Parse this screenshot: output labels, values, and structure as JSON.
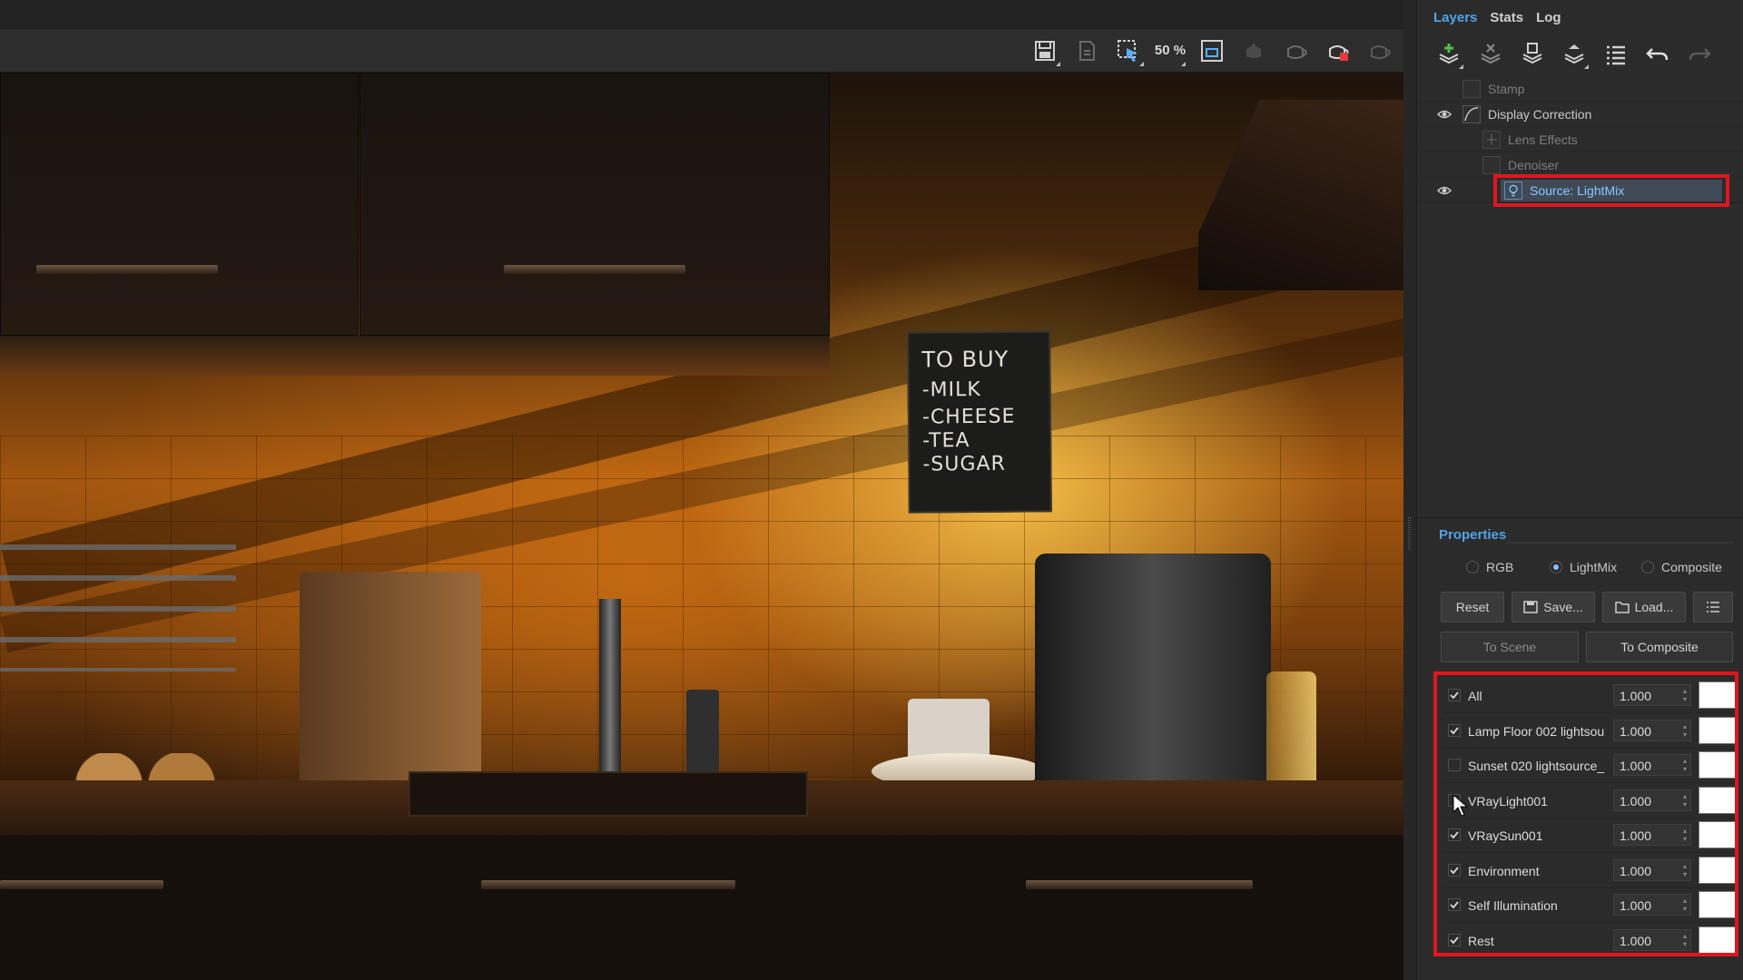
{
  "toolbar": {
    "zoom_label": "50 %",
    "icons": [
      "save-icon",
      "save-all-icon",
      "region-select-icon",
      "zoom-icon",
      "frame-icon",
      "teapot-icon",
      "teapot-outline-icon",
      "teapot-render-icon",
      "teapot-stop-icon"
    ]
  },
  "render": {
    "chalkboard_lines": [
      "TO BUY",
      "-MILK",
      "-CHEESE",
      "-TEA",
      "-SUGAR"
    ]
  },
  "panel": {
    "tabs": [
      {
        "label": "Layers",
        "active": true
      },
      {
        "label": "Stats",
        "active": false
      },
      {
        "label": "Log",
        "active": false
      }
    ],
    "layers": [
      {
        "name": "Stamp",
        "visible": false,
        "dim": true
      },
      {
        "name": "Display Correction",
        "visible": true,
        "dim": false
      },
      {
        "name": "Lens Effects",
        "visible": false,
        "dim": true
      },
      {
        "name": "Denoiser",
        "visible": false,
        "dim": true
      },
      {
        "name": "Source: LightMix",
        "visible": true,
        "dim": false,
        "selected": true
      }
    ],
    "properties": {
      "title": "Properties",
      "modes": [
        {
          "label": "RGB",
          "selected": false
        },
        {
          "label": "LightMix",
          "selected": true
        },
        {
          "label": "Composite",
          "selected": false
        }
      ],
      "buttons": {
        "reset": "Reset",
        "save": "Save...",
        "load": "Load...",
        "to_scene": "To Scene",
        "to_composite": "To Composite"
      },
      "lights": [
        {
          "name": "All",
          "checked": true,
          "value": "1.000",
          "color": "#ffffff"
        },
        {
          "name": "Lamp Floor 002 lightsou",
          "checked": true,
          "value": "1.000",
          "color": "#ffffff"
        },
        {
          "name": "Sunset 020 lightsource_",
          "checked": false,
          "value": "1.000",
          "color": "#ffffff"
        },
        {
          "name": "VRayLight001",
          "checked": false,
          "value": "1.000",
          "color": "#ffffff"
        },
        {
          "name": "VRaySun001",
          "checked": true,
          "value": "1.000",
          "color": "#ffffff"
        },
        {
          "name": "Environment",
          "checked": true,
          "value": "1.000",
          "color": "#ffffff"
        },
        {
          "name": "Self Illumination",
          "checked": true,
          "value": "1.000",
          "color": "#ffffff"
        },
        {
          "name": "Rest",
          "checked": true,
          "value": "1.000",
          "color": "#ffffff"
        }
      ]
    }
  },
  "colors": {
    "accent": "#4fa3e8",
    "highlight_box": "#e0161e",
    "panel_bg": "#2b2b2b"
  }
}
